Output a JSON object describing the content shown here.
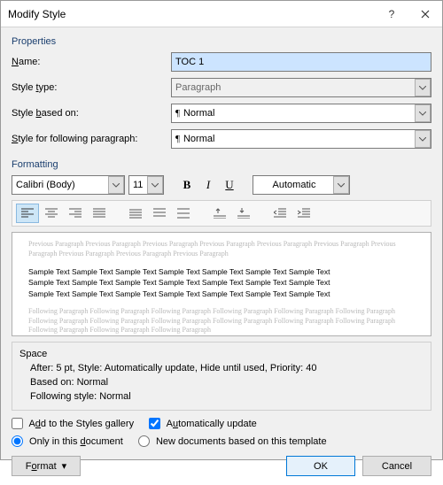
{
  "titlebar": {
    "title": "Modify Style"
  },
  "sections": {
    "properties": "Properties",
    "formatting": "Formatting"
  },
  "props": {
    "name_label": "Name:",
    "name_value": "TOC 1",
    "type_label": "Style type:",
    "type_value": "Paragraph",
    "based_label": "Style based on:",
    "based_value": "Normal",
    "following_label": "Style for following paragraph:",
    "following_value": "Normal"
  },
  "format": {
    "font_name": "Calibri (Body)",
    "font_size": "11",
    "bold": "B",
    "italic": "I",
    "underline": "U",
    "color": "Automatic"
  },
  "preview": {
    "ghost_prev": "Previous Paragraph Previous Paragraph Previous Paragraph Previous Paragraph Previous Paragraph Previous Paragraph Previous Paragraph Previous Paragraph Previous Paragraph Previous Paragraph",
    "sample1": "Sample Text Sample Text Sample Text Sample Text Sample Text Sample Text Sample Text",
    "sample2": "Sample Text Sample Text Sample Text Sample Text Sample Text Sample Text Sample Text",
    "sample3": "Sample Text Sample Text Sample Text Sample Text Sample Text Sample Text Sample Text",
    "ghost_next": "Following Paragraph Following Paragraph Following Paragraph Following Paragraph Following Paragraph Following Paragraph Following Paragraph Following Paragraph Following Paragraph Following Paragraph Following Paragraph Following Paragraph Following Paragraph Following Paragraph Following Paragraph"
  },
  "desc": {
    "space_label": "Space",
    "line1": "After:  5 pt, Style: Automatically update, Hide until used, Priority: 40",
    "line2": "Based on: Normal",
    "line3": "Following style: Normal"
  },
  "checks": {
    "add_gallery": "Add to the Styles gallery",
    "auto_update": "Automatically update",
    "only_doc": "Only in this document",
    "new_docs": "New documents based on this template"
  },
  "buttons": {
    "format": "Format",
    "ok": "OK",
    "cancel": "Cancel"
  }
}
